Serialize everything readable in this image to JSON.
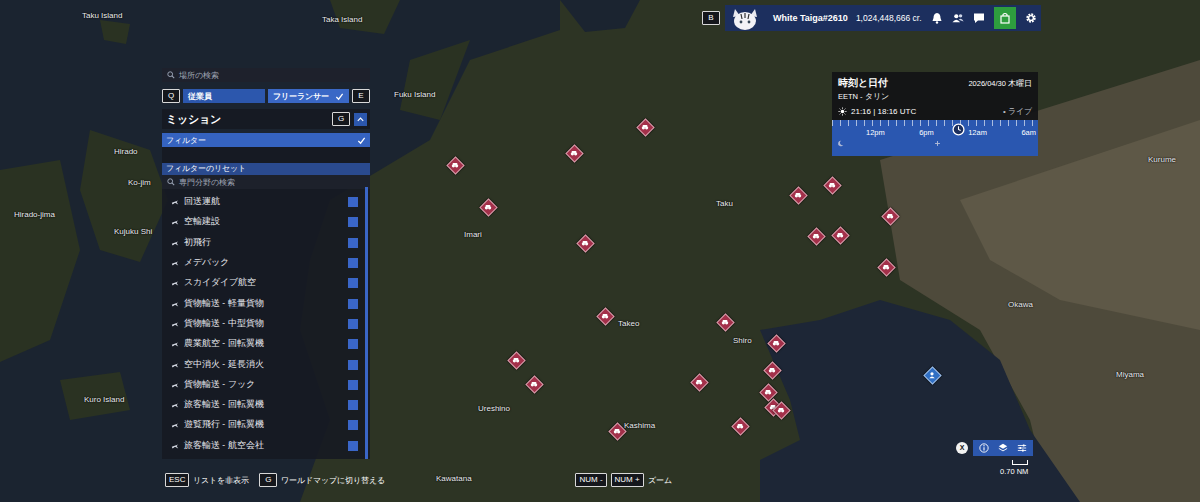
{
  "map": {
    "labels": [
      "Taku Island",
      "Taka Island",
      "Fuku Island",
      "Hirado",
      "Ko-jim",
      "Hirado-jima",
      "Kujuku Shi",
      "Kuro Island",
      "Imari",
      "Taku",
      "Takeo",
      "Shiro",
      "Ureshino",
      "Kashima",
      "Kawatana",
      "Kurume",
      "Okawa",
      "Miyama"
    ],
    "pins": [
      {
        "kind": "mission",
        "color": "#a3304a"
      },
      {
        "kind": "mission",
        "color": "#a3304a"
      },
      {
        "kind": "mission",
        "color": "#a3304a"
      },
      {
        "kind": "mission",
        "color": "#a3304a"
      },
      {
        "kind": "mission",
        "color": "#a3304a"
      },
      {
        "kind": "mission",
        "color": "#a3304a"
      },
      {
        "kind": "mission",
        "color": "#a3304a"
      },
      {
        "kind": "mission",
        "color": "#a3304a"
      },
      {
        "kind": "mission",
        "color": "#a3304a"
      },
      {
        "kind": "mission",
        "color": "#a3304a"
      },
      {
        "kind": "mission",
        "color": "#a3304a"
      },
      {
        "kind": "mission",
        "color": "#a3304a"
      },
      {
        "kind": "mission",
        "color": "#a3304a"
      },
      {
        "kind": "mission",
        "color": "#a3304a"
      },
      {
        "kind": "mission",
        "color": "#a3304a"
      },
      {
        "kind": "mission",
        "color": "#a3304a"
      },
      {
        "kind": "mission",
        "color": "#a3304a"
      },
      {
        "kind": "mission",
        "color": "#a3304a"
      },
      {
        "kind": "mission",
        "color": "#a3304a"
      },
      {
        "kind": "mission",
        "color": "#a3304a"
      },
      {
        "kind": "mission",
        "color": "#a3304a"
      },
      {
        "kind": "mission",
        "color": "#a3304a"
      },
      {
        "kind": "mission",
        "color": "#a3304a"
      },
      {
        "kind": "freelancer",
        "color": "#2f6fc4"
      }
    ],
    "scale": "0.70 NM"
  },
  "top_bar": {
    "key": "B",
    "user": "White Taiga#2610",
    "credits": "1,024,448,666 cr."
  },
  "search": {
    "placeholder": "場所の検索"
  },
  "roster_tabs": {
    "prev_key": "Q",
    "next_key": "E",
    "tabs": [
      {
        "label": "従業員",
        "selected": false
      },
      {
        "label": "フリーランサー",
        "selected": true
      }
    ]
  },
  "missions_panel": {
    "title": "ミッション",
    "key": "G",
    "expanded": true,
    "filter": {
      "label": "フィルター",
      "expanded": true
    },
    "reset": "フィルターのリセット",
    "search_placeholder": "専門分野の検索",
    "items": [
      {
        "label": "回送運航",
        "checked": true
      },
      {
        "label": "空輸建設",
        "checked": true
      },
      {
        "label": "初飛行",
        "checked": true
      },
      {
        "label": "メデバック",
        "checked": true
      },
      {
        "label": "スカイダイブ航空",
        "checked": true
      },
      {
        "label": "貨物輸送 - 軽量貨物",
        "checked": true
      },
      {
        "label": "貨物輸送 - 中型貨物",
        "checked": true
      },
      {
        "label": "農業航空 - 回転翼機",
        "checked": true
      },
      {
        "label": "空中消火 - 延長消火",
        "checked": true
      },
      {
        "label": "貨物輸送 - フック",
        "checked": true
      },
      {
        "label": "旅客輸送 - 回転翼機",
        "checked": true
      },
      {
        "label": "遊覧飛行 - 回転翼機",
        "checked": true
      },
      {
        "label": "旅客輸送 - 航空会社",
        "checked": true
      }
    ]
  },
  "time_panel": {
    "title": "時刻と日付",
    "date": "2026/04/30 木曜日",
    "zone": "EETN - タリン",
    "time": "21:16 | 18:16 UTC",
    "live": "• ライブ",
    "ticks": [
      "12pm",
      "6pm",
      "12am",
      "6am"
    ],
    "level": 0.61
  },
  "hints": [
    {
      "keys": [
        "ESC"
      ],
      "label": "リストを非表示"
    },
    {
      "keys": [
        "G"
      ],
      "label": "ワールドマップに切り替える"
    },
    {
      "keys": [
        "NUM -",
        "NUM +"
      ],
      "label": "ズーム"
    }
  ],
  "map_tools": {
    "key": "X"
  }
}
